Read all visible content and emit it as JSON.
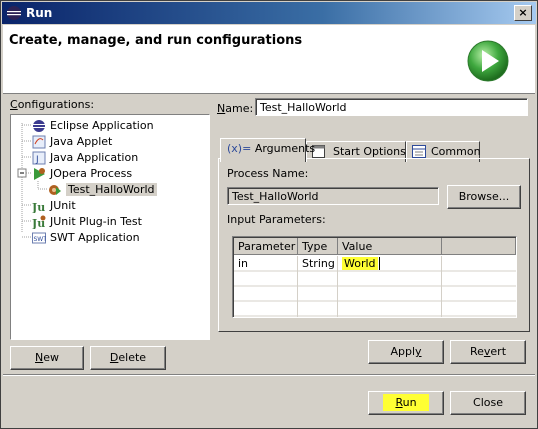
{
  "window": {
    "title": "Run",
    "close_glyph": "×"
  },
  "banner": {
    "title": "Create, manage, and run configurations",
    "icon": "run-icon"
  },
  "configurations": {
    "label_mn": "C",
    "label_rest": "onfigurations:",
    "items": [
      {
        "label": "Eclipse Application",
        "icon": "eclipse-icon"
      },
      {
        "label": "Java Applet",
        "icon": "java-applet-icon"
      },
      {
        "label": "Java Application",
        "icon": "java-app-icon"
      },
      {
        "label": "JOpera Process",
        "icon": "jopera-icon",
        "expanded": true
      },
      {
        "label": "Test_HalloWorld",
        "icon": "jopera-process-icon",
        "selected": true
      },
      {
        "label": "JUnit",
        "icon": "junit-icon"
      },
      {
        "label": "JUnit Plug-in Test",
        "icon": "junit-plugin-icon"
      },
      {
        "label": "SWT Application",
        "icon": "swt-icon"
      }
    ],
    "new_label": {
      "mn": "N",
      "rest": "ew"
    },
    "delete_label": {
      "mn": "D",
      "rest": "elete"
    }
  },
  "name": {
    "label_mn": "N",
    "label_rest": "ame:",
    "value": "Test_HalloWorld"
  },
  "tabs": [
    {
      "label": "Arguments",
      "prefix": "(x)=",
      "active": true
    },
    {
      "label": "Start Options"
    },
    {
      "label": "Common"
    }
  ],
  "process": {
    "label": "Process Name:",
    "value": "Test_HalloWorld",
    "browse": "Browse..."
  },
  "params": {
    "label": "Input Parameters:",
    "columns": [
      "Parameter",
      "Type",
      "Value"
    ],
    "rows": [
      {
        "parameter": "in",
        "type": "String",
        "value": "World"
      }
    ]
  },
  "actions": {
    "apply": {
      "mn": "y",
      "pre": "Appl",
      "post": ""
    },
    "revert": {
      "pre": "Re",
      "mn": "v",
      "post": "ert"
    },
    "run": {
      "mn": "R",
      "rest": "un"
    },
    "close": "Close"
  },
  "colors": {
    "title_bar": "#0a246a",
    "highlight": "#ffff33",
    "run_icon": "#3fa83f"
  }
}
